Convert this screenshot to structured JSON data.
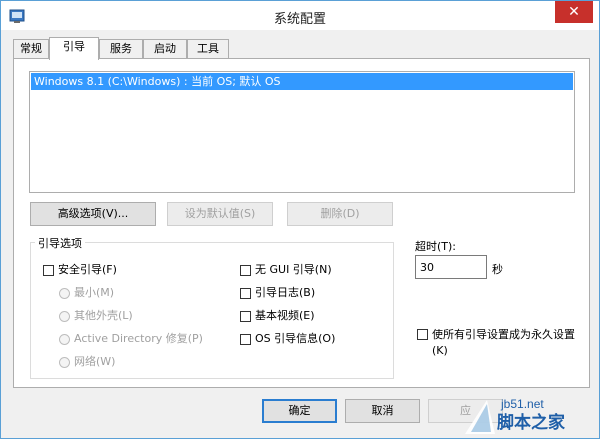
{
  "window": {
    "title": "系统配置",
    "close_glyph": "✕"
  },
  "tabs": [
    {
      "label": "常规"
    },
    {
      "label": "引导"
    },
    {
      "label": "服务"
    },
    {
      "label": "启动"
    },
    {
      "label": "工具"
    }
  ],
  "boot_list": {
    "items": [
      {
        "label": "Windows 8.1 (C:\\Windows) : 当前 OS; 默认 OS"
      }
    ]
  },
  "buttons": {
    "advanced": "高级选项(V)...",
    "set_default": "设为默认值(S)",
    "delete": "删除(D)"
  },
  "boot_options": {
    "title": "引导选项",
    "safe_boot": "安全引导(F)",
    "minimal": "最小(M)",
    "alternate_shell": "其他外壳(L)",
    "active_directory": "Active Directory 修复(P)",
    "network": "网络(W)",
    "no_gui": "无 GUI 引导(N)",
    "boot_log": "引导日志(B)",
    "base_video": "基本视频(E)",
    "os_boot_info": "OS 引导信息(O)"
  },
  "timeout": {
    "label": "超时(T):",
    "value": "30",
    "unit": "秒"
  },
  "permanent": {
    "label": "使所有引导设置成为永久设置(K)"
  },
  "footer": {
    "ok": "确定",
    "cancel": "取消",
    "apply": "应"
  },
  "watermark": {
    "site": "jb51.net",
    "brand": "脚本之家"
  },
  "colors": {
    "selection": "#3399ff",
    "close": "#c7302b",
    "default_button_border": "#2a7dd0"
  }
}
